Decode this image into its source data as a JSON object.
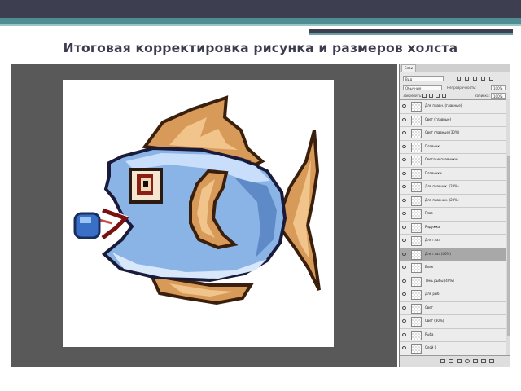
{
  "slide": {
    "title": "Итоговая корректировка рисунка и размеров холста"
  },
  "panel": {
    "tab_label": "Слои",
    "filter": {
      "kind_label": "Вид"
    },
    "blend_mode": "Обычные",
    "opacity_label": "Непрозрачность:",
    "opacity_value": "100%",
    "lock_label": "Закрепить:",
    "fill_label": "Заливка:",
    "fill_value": "100%",
    "layers": [
      {
        "name": "Для плавн. (главные)",
        "selected": false
      },
      {
        "name": "Свет (главные)",
        "selected": false
      },
      {
        "name": "Свет главные (30%)",
        "selected": false
      },
      {
        "name": "Плавник",
        "selected": false
      },
      {
        "name": "Светлые плавники",
        "selected": false
      },
      {
        "name": "Плавники",
        "selected": false
      },
      {
        "name": "Для плавник. (20%)",
        "selected": false
      },
      {
        "name": "Для плавник. (20%)",
        "selected": false
      },
      {
        "name": "Глаз",
        "selected": false
      },
      {
        "name": "Радужка",
        "selected": false
      },
      {
        "name": "Для глаз",
        "selected": false
      },
      {
        "name": "Для глаз (40%)",
        "selected": true
      },
      {
        "name": "Блик",
        "selected": false
      },
      {
        "name": "Тень рыбы (40%)",
        "selected": false
      },
      {
        "name": "Для рыб",
        "selected": false
      },
      {
        "name": "Свет",
        "selected": false
      },
      {
        "name": "Свет (30%)",
        "selected": false
      },
      {
        "name": "Рыба",
        "selected": false
      },
      {
        "name": "Слой 0",
        "selected": false
      }
    ],
    "icons": {
      "eye": "eye-icon",
      "footer": [
        "link-icon",
        "fx-icon",
        "mask-icon",
        "adjustment-icon",
        "group-icon",
        "new-layer-icon",
        "trash-icon"
      ]
    }
  },
  "colors": {
    "title": "#3b3c4d",
    "workspace": "#595959",
    "selected_layer": "#a8a8a8"
  }
}
